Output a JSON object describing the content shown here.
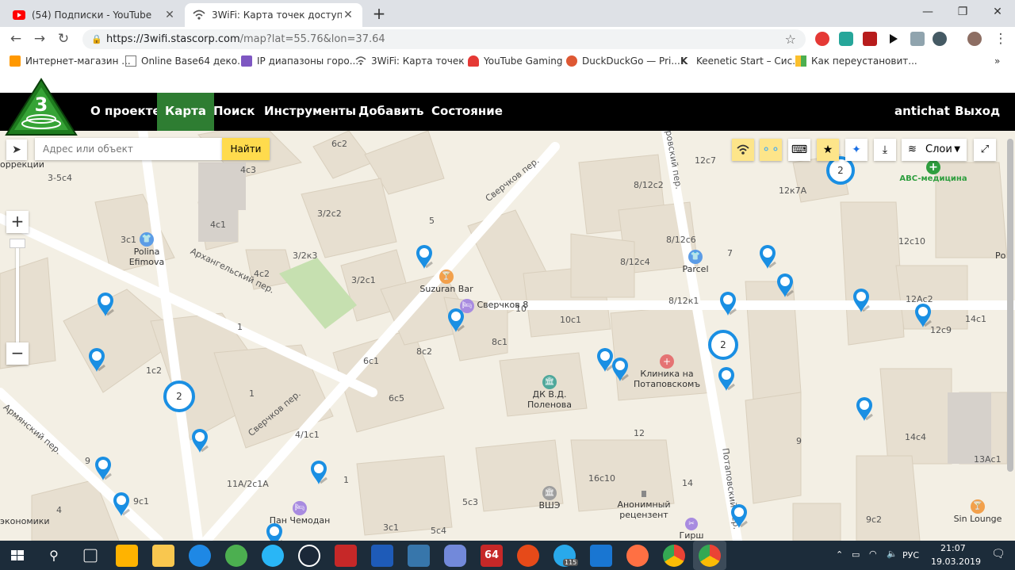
{
  "browser": {
    "tabs": [
      {
        "title": "(54) Подписки - YouTube",
        "icon": "youtube-icon",
        "active": false
      },
      {
        "title": "3WiFi: Карта точек доступа",
        "icon": "wifi-icon",
        "active": true
      }
    ],
    "new_tab": "+",
    "window_controls": {
      "minimize": "—",
      "restore": "❐",
      "close": "✕"
    },
    "url": {
      "base": "https://3wifi.stascorp.com",
      "path": "/map?lat=55.76&lon=37.64"
    },
    "bookmarks": [
      {
        "label": "Интернет-магазин ...",
        "icon": "shop-icon"
      },
      {
        "label": "Online Base64 деко...",
        "icon": "page-icon"
      },
      {
        "label": "IP диапазоны горо...",
        "icon": "ip-icon"
      },
      {
        "label": "3WiFi: Карта точек ...",
        "icon": "wifi-icon"
      },
      {
        "label": "YouTube Gaming",
        "icon": "youtube-gaming-icon"
      },
      {
        "label": "DuckDuckGo — Pri...",
        "icon": "duckduckgo-icon"
      },
      {
        "label": "Keenetic Start – Сис...",
        "icon": "keenetic-icon"
      },
      {
        "label": "Как переустановит...",
        "icon": "article-icon"
      }
    ],
    "bookmarks_more": "»"
  },
  "site": {
    "nav": [
      "О проекте",
      "Карта",
      "Поиск",
      "Инструменты",
      "Добавить",
      "Состояние"
    ],
    "active_nav": "Карта",
    "user": "antichat",
    "logout": "Выход"
  },
  "map": {
    "search_placeholder": "Адрес или объект",
    "search_button": "Найти",
    "zoom_in": "+",
    "zoom_out": "−",
    "layers_label": "Слои",
    "streets": [
      "Сверчков пер.",
      "Сверчков пер.",
      "Архангельский пер.",
      "Армянский пер.",
      "Потаповский пер.",
      "ровский пер."
    ],
    "buildings": [
      "6с2",
      "4с3",
      "4с1",
      "3/2с2",
      "5",
      "3/2к3",
      "3/2с1",
      "4с2",
      "3с1",
      "1",
      "1с2",
      "1",
      "8/12с2",
      "8/12с6",
      "8/12с4",
      "7",
      "8/12к1",
      "12с7",
      "12к7А",
      "12с10",
      "10",
      "10с1",
      "8с1",
      "6с1",
      "8с2",
      "6с5",
      "4/1с1",
      "1",
      "11А/2с1А",
      "9",
      "9с1",
      "4",
      "5с3",
      "3с1",
      "5с4",
      "12",
      "16с10",
      "14",
      "9",
      "14с4",
      "14с1",
      "12с9",
      "12Ас2",
      "13Ас1",
      "9с2",
      "3-5с4"
    ],
    "pois": [
      {
        "name": "Polina Efimova",
        "type": "clothes"
      },
      {
        "name": "Suzuran Bar",
        "type": "bar"
      },
      {
        "name": "Сверчков 8",
        "type": "hotel"
      },
      {
        "name": "Parcel",
        "type": "clothes"
      },
      {
        "name": "ДК В.Д. Поленова",
        "type": "culture"
      },
      {
        "name": "Клиника на Потаповскомъ",
        "type": "clinic"
      },
      {
        "name": "ABC-медицина",
        "type": "medical"
      },
      {
        "name": "ВШЭ",
        "type": "university"
      },
      {
        "name": "Анонимный рецензент",
        "type": "place"
      },
      {
        "name": "Пан Чемодан",
        "type": "hotel"
      },
      {
        "name": "Гирш",
        "type": "barber"
      },
      {
        "name": "Sin Lounge",
        "type": "bar"
      }
    ],
    "edge_labels": [
      "оррекции",
      "экономики",
      "Ро"
    ],
    "clusters": [
      "2",
      "2",
      "2"
    ]
  },
  "taskbar": {
    "lang": "РУС",
    "time": "21:07",
    "date": "19.03.2019",
    "badge": "115"
  },
  "colors": {
    "accent_green": "#2e7d32",
    "pin_blue": "#1a8fe3",
    "search_yellow": "#ffdb4d"
  }
}
